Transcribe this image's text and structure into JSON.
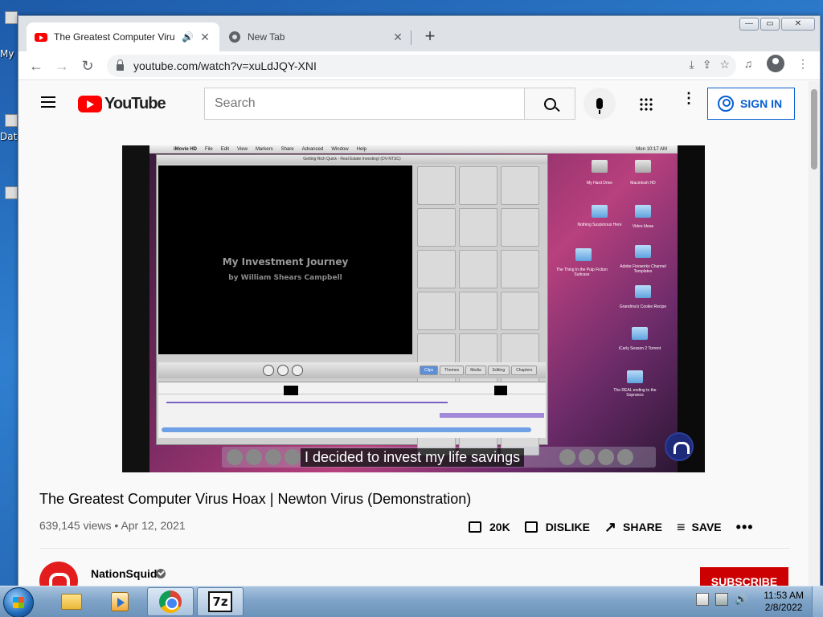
{
  "desktop": {
    "icons": [
      {
        "label": "My"
      },
      {
        "label": "Dat"
      }
    ]
  },
  "browser": {
    "tabs": [
      {
        "title": "The Greatest Computer Viru",
        "active": true,
        "audio": "🔊",
        "close": "✕"
      },
      {
        "title": "New Tab",
        "active": false,
        "close": "✕"
      }
    ],
    "new_tab": "+",
    "window_controls": {
      "minimize": "—",
      "restore": "▭",
      "close": "✕"
    },
    "nav": {
      "back": "←",
      "forward": "→",
      "reload": "↻"
    },
    "url": "youtube.com/watch?v=xuLdJQY-XNI",
    "omni_icons": {
      "install": "⤓",
      "share": "⇪",
      "bookmark": "☆"
    },
    "tools": {
      "media": "♫",
      "menu": "⋮"
    }
  },
  "youtube": {
    "logo_text": "YouTube",
    "search_placeholder": "Search",
    "more_icon": "⋮",
    "sign_in_label": "SIGN IN",
    "video": {
      "caption": "I decided to invest my life savings",
      "inner": {
        "menubar": [
          "iMovie HD",
          "File",
          "Edit",
          "View",
          "Markers",
          "Share",
          "Advanced",
          "Window",
          "Help"
        ],
        "clock": "Mon 10:17 AM",
        "window_title": "Getting Rich Quick - Real Estate Investing! (DV-NTSC)",
        "viewer_title": "My Investment Journey",
        "viewer_subtitle": "by William Shears Campbell",
        "tabs": [
          "Clips",
          "Themes",
          "Media",
          "Editing",
          "Chapters"
        ],
        "desktop_icons": [
          "My Hard Drive",
          "Macintosh HD",
          "Nothing Suspicious Here",
          "Video Ideas",
          "The Thing In the Pulp Fiction Suitcase",
          "Adobe Fireworks Channel Templates",
          "Grandma's Cookie Recipe",
          "iCarly Season 2 Torrent",
          "The REAL ending to the Sopranos"
        ]
      }
    },
    "title": "The Greatest Computer Virus Hoax | Newton Virus (Demonstration)",
    "views": "639,145 views",
    "date": "Apr 12, 2021",
    "meta_sep": " • ",
    "actions": {
      "like_count": "20K",
      "dislike_label": "DISLIKE",
      "share_label": "SHARE",
      "save_label": "SAVE",
      "more": "•••"
    },
    "channel": {
      "name": "NationSquid",
      "subscribe_label": "SUBSCRIBE"
    }
  },
  "taskbar": {
    "apps": [
      "explorer",
      "media-player",
      "chrome",
      "7-zip"
    ],
    "sevenz_label": "7z",
    "time": "11:53 AM",
    "date": "2/8/2022"
  }
}
